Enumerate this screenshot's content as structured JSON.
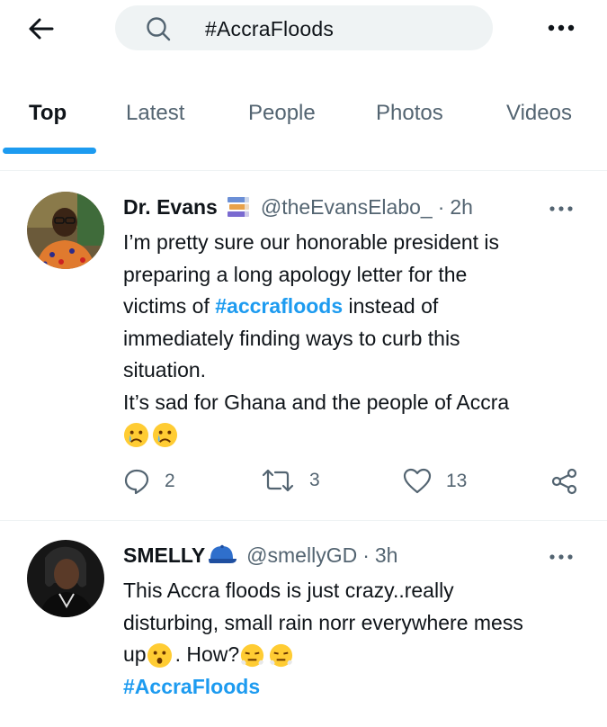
{
  "search": {
    "query": "#AccraFloods"
  },
  "icons": {
    "back": "arrow-left-icon",
    "search": "search-icon",
    "more": "more-icon",
    "reply": "reply-icon",
    "retweet": "retweet-icon",
    "like": "heart-icon",
    "share": "share-icon"
  },
  "tabs": [
    {
      "label": "Top",
      "active": true
    },
    {
      "label": "Latest",
      "active": false
    },
    {
      "label": "People",
      "active": false
    },
    {
      "label": "Photos",
      "active": false
    },
    {
      "label": "Videos",
      "active": false
    }
  ],
  "colors": {
    "accent": "#1d9bf0",
    "text_primary": "#0f1419",
    "text_secondary": "#536471",
    "search_bg": "#eff3f4"
  },
  "tweets": [
    {
      "name": "Dr. Evans",
      "name_badge": "books-emoji",
      "handle": "@theEvansElabo_",
      "dot": "·",
      "time": "2h",
      "body": {
        "line1": "I’m pretty sure our honorable president is",
        "line2": "preparing a long apology letter for the",
        "line3_pre": "victims of ",
        "line3_hashtag": "#accrafloods",
        "line3_post": " instead of",
        "line4": "immediately finding ways to curb this",
        "line5": "situation.",
        "line6": "It’s sad for Ghana and the people of Accra",
        "line7_emojis": [
          "crying-face-emoji",
          "crying-face-emoji"
        ]
      },
      "replies": "2",
      "retweets": "3",
      "likes": "13"
    },
    {
      "name": "SMELLY",
      "name_badge": "blue-cap-emoji",
      "handle": "@smellyGD",
      "dot": "·",
      "time": "3h",
      "body": {
        "line1": "This Accra floods is just crazy..really",
        "line2": "disturbing, small rain norr everywhere mess",
        "line3_pre": "up",
        "line3_post": ". How?",
        "line3_emojis": [
          "hushed-face-emoji",
          "steam-face-emoji",
          "steam-face-emoji"
        ],
        "line4_hashtag": "#AccraFloods"
      }
    }
  ]
}
